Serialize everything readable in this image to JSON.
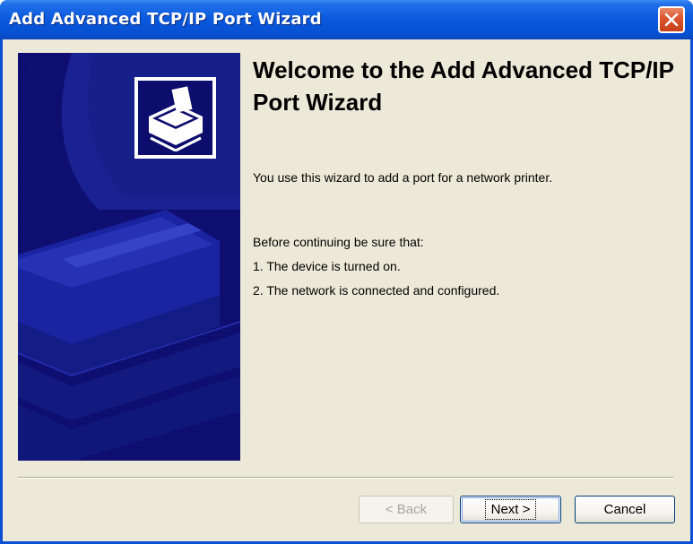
{
  "window": {
    "title": "Add Advanced TCP/IP Port Wizard",
    "close_icon": "close-icon"
  },
  "banner": {
    "icon": "printer-icon",
    "background_color": "#0d0d6e"
  },
  "content": {
    "heading": "Welcome to the Add Advanced TCP/IP Port Wizard",
    "intro": "You use this wizard to add a port for a network printer.",
    "checklist_title": "Before continuing be sure that:",
    "checklist": [
      "1. The device is turned on.",
      "2. The network is connected and configured."
    ]
  },
  "buttons": {
    "back_label": "< Back",
    "back_enabled": false,
    "next_label": "Next >",
    "cancel_label": "Cancel"
  },
  "colors": {
    "titlebar": "#0a58dc",
    "dialog_background": "#ece9d8",
    "close_button": "#d9532c"
  }
}
